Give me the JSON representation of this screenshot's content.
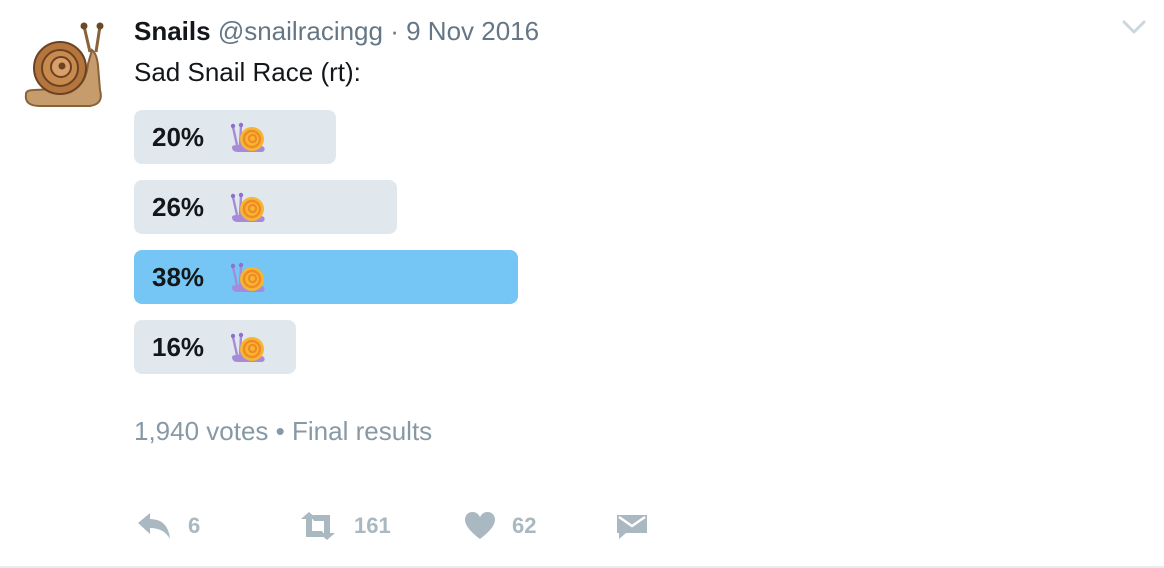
{
  "tweet": {
    "display_name": "Snails",
    "handle": "@snailracingg",
    "separator": "·",
    "date": "9 Nov 2016",
    "text": "Sad Snail Race (rt):"
  },
  "poll": {
    "choices": [
      {
        "percent_label": "20%",
        "percent": 20,
        "icon": "snail-icon",
        "winner": false
      },
      {
        "percent_label": "26%",
        "percent": 26,
        "icon": "snail-icon",
        "winner": false
      },
      {
        "percent_label": "38%",
        "percent": 38,
        "icon": "snail-icon",
        "winner": true
      },
      {
        "percent_label": "16%",
        "percent": 16,
        "icon": "snail-icon",
        "winner": false
      }
    ],
    "votes": "1,940 votes",
    "bullet": "•",
    "status": "Final results"
  },
  "actions": {
    "reply_count": "6",
    "retweet_count": "161",
    "like_count": "62"
  },
  "colors": {
    "winner_bar": "#75c6f5",
    "bar": "#e1e8ed",
    "muted": "#8899a6",
    "icon": "#aab8c2"
  }
}
